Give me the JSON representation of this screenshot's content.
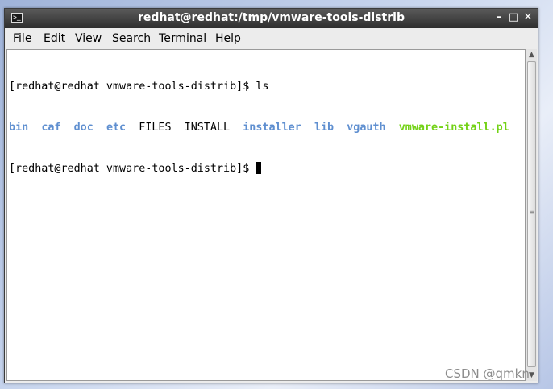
{
  "window": {
    "title": "redhat@redhat:/tmp/vmware-tools-distrib",
    "icon": "terminal-icon",
    "controls": {
      "minimize": "✕",
      "maximize": "□",
      "close": "✕"
    }
  },
  "menu": {
    "file": {
      "accel": "F",
      "rest": "ile"
    },
    "edit": {
      "accel": "E",
      "rest": "dit"
    },
    "view": {
      "accel": "V",
      "rest": "iew"
    },
    "search": {
      "accel": "S",
      "rest": "earch"
    },
    "terminal": {
      "accel": "T",
      "rest": "erminal"
    },
    "help": {
      "accel": "H",
      "rest": "elp"
    }
  },
  "terminal": {
    "prompt1": "[redhat@redhat vmware-tools-distrib]$ ",
    "command1": "ls",
    "listing": [
      {
        "name": "bin",
        "kind": "dir",
        "sep": "  "
      },
      {
        "name": "caf",
        "kind": "dir",
        "sep": "  "
      },
      {
        "name": "doc",
        "kind": "dir",
        "sep": "  "
      },
      {
        "name": "etc",
        "kind": "dir",
        "sep": "  "
      },
      {
        "name": "FILES",
        "kind": "file",
        "sep": "  "
      },
      {
        "name": "INSTALL",
        "kind": "file",
        "sep": "  "
      },
      {
        "name": "installer",
        "kind": "dir",
        "sep": "  "
      },
      {
        "name": "lib",
        "kind": "dir",
        "sep": "  "
      },
      {
        "name": "vgauth",
        "kind": "dir",
        "sep": "  "
      },
      {
        "name": "vmware-install.pl",
        "kind": "exe",
        "sep": ""
      }
    ],
    "prompt2": "[redhat@redhat vmware-tools-distrib]$ ",
    "colors": {
      "dir": "#5f8fd0",
      "exe": "#73d216"
    }
  },
  "watermark": "CSDN @qmkn"
}
